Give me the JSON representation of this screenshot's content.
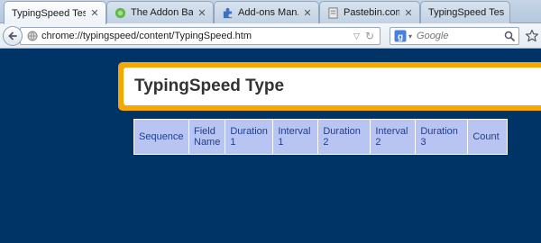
{
  "browser": {
    "tabs": [
      {
        "title": "TypingSpeed Test",
        "icon": "page-icon",
        "active": true,
        "closable": true
      },
      {
        "title": "The Addon Ba...",
        "icon": "puzzle-icon",
        "active": false,
        "closable": true
      },
      {
        "title": "Add-ons Man...",
        "icon": "addon-icon",
        "active": false,
        "closable": true
      },
      {
        "title": "Pastebin.com ...",
        "icon": "pastebin-icon",
        "active": false,
        "closable": true
      },
      {
        "title": "TypingSpeed Test",
        "icon": "page-icon",
        "active": false,
        "closable": false
      }
    ],
    "url": "chrome://typingspeed/content/TypingSpeed.htm",
    "search": {
      "placeholder": "Google",
      "engine_icon": "google-icon"
    }
  },
  "page": {
    "title": "TypingSpeed Type",
    "table": {
      "headers": [
        "Sequence",
        "Field Name",
        "Duration 1",
        "Interval 1",
        "Duration 2",
        "Interval 2",
        "Duration 3",
        "Count"
      ]
    }
  },
  "colors": {
    "page_background": "#003366",
    "title_border": "#f6a800",
    "table_background": "#b8c4f2",
    "table_text": "#1f3f8f"
  }
}
